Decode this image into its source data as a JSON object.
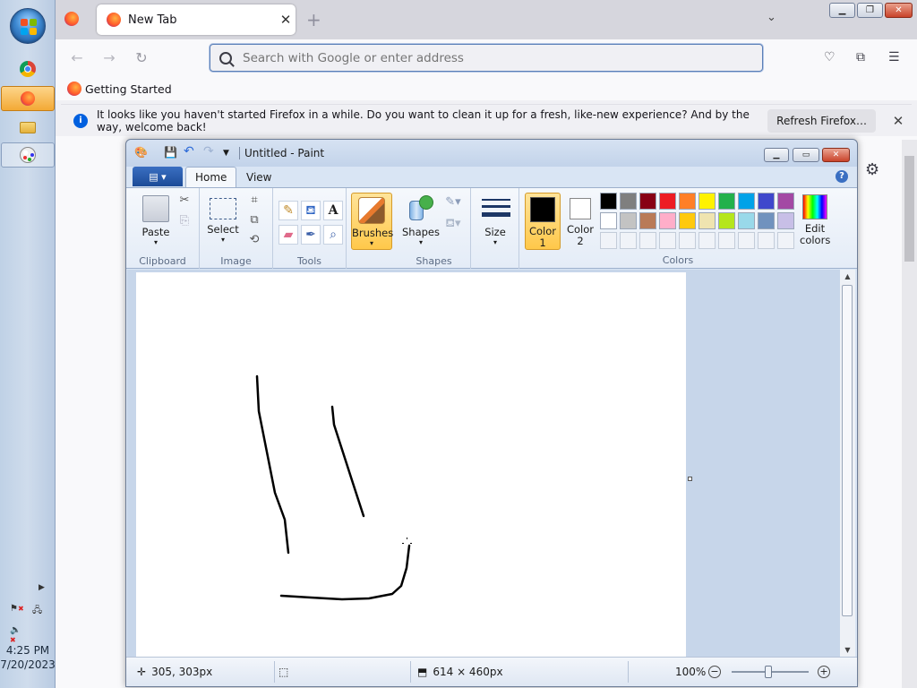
{
  "taskbar": {
    "clock_time": "4:25 PM",
    "clock_date": "7/20/2023",
    "icons": [
      "start-orb",
      "chrome-icon",
      "firefox-icon",
      "file-explorer-icon",
      "paint-icon"
    ]
  },
  "firefox": {
    "tab_title": "New Tab",
    "url_placeholder": "Search with Google or enter address",
    "bookmark_label": "Getting Started",
    "notification_text": "It looks like you haven't started Firefox in a while. Do you want to clean it up for a fresh, like-new experience? And by the way, welcome back!",
    "refresh_button_label": "Refresh Firefox…"
  },
  "paint": {
    "window_title": "Untitled - Paint",
    "tabs": {
      "home": "Home",
      "view": "View"
    },
    "groups": {
      "clipboard": "Clipboard",
      "image": "Image",
      "tools": "Tools",
      "shapes": "Shapes",
      "colors": "Colors"
    },
    "buttons": {
      "paste": "Paste",
      "select": "Select",
      "brushes": "Brushes",
      "shapes": "Shapes",
      "size": "Size",
      "color1_line1": "Color",
      "color1_line2": "1",
      "color2_line1": "Color",
      "color2_line2": "2",
      "edit_colors_line1": "Edit",
      "edit_colors_line2": "colors"
    },
    "palette": [
      "#000000",
      "#7f7f7f",
      "#880015",
      "#ed1c24",
      "#ff7f27",
      "#fff200",
      "#22b14c",
      "#00a2e8",
      "#3f48cc",
      "#a349a4",
      "#ffffff",
      "#c3c3c3",
      "#b97a57",
      "#ffaec9",
      "#ffc90e",
      "#efe4b0",
      "#b5e61d",
      "#99d9ea",
      "#7092be",
      "#c8bfe7",
      "",
      "",
      "",
      "",
      "",
      "",
      "",
      "",
      "",
      ""
    ],
    "color1": "#000000",
    "color2": "#ffffff",
    "status": {
      "cursor_position": "305, 303px",
      "image_size": "614 × 460px",
      "zoom": "100%"
    }
  }
}
